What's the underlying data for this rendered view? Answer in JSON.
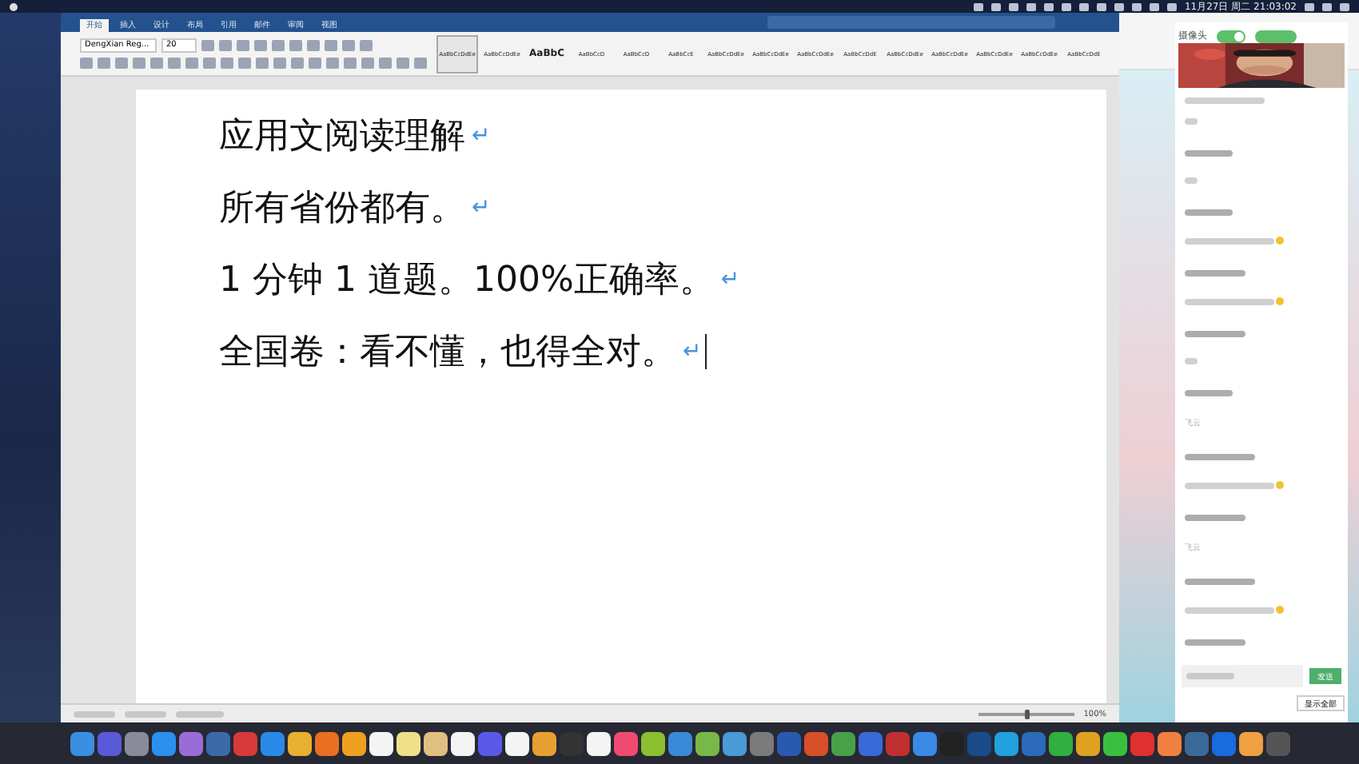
{
  "menu_bar": {
    "clock": "11月27日 周二 21:03:02"
  },
  "word": {
    "tabs": [
      {
        "label": "开始",
        "selected": true
      },
      {
        "label": "插入",
        "selected": false
      },
      {
        "label": "设计",
        "selected": false
      },
      {
        "label": "布局",
        "selected": false
      },
      {
        "label": "引用",
        "selected": false
      },
      {
        "label": "邮件",
        "selected": false
      },
      {
        "label": "审阅",
        "selected": false
      },
      {
        "label": "视图",
        "selected": false
      }
    ],
    "font": "DengXian Reg...",
    "size": "20",
    "styles": [
      {
        "sample": "AaBbCcDdEe",
        "selected": true
      },
      {
        "sample": "AaBbCcDdEe",
        "selected": false
      },
      {
        "sample": "AaBbC",
        "selected": false
      },
      {
        "sample": "AaBbCcD",
        "selected": false
      },
      {
        "sample": "AaBbCcD",
        "selected": false
      },
      {
        "sample": "AaBbCcE",
        "selected": false
      },
      {
        "sample": "AaBbCcDdEe",
        "selected": false
      },
      {
        "sample": "AaBbCcDdEe",
        "selected": false
      },
      {
        "sample": "AaBbCcDdEe",
        "selected": false
      },
      {
        "sample": "AaBbCcDdE",
        "selected": false
      },
      {
        "sample": "AaBbCcDdEe",
        "selected": false
      },
      {
        "sample": "AaBbCcDdEe",
        "selected": false
      },
      {
        "sample": "AaBbCcDdEe",
        "selected": false
      },
      {
        "sample": "AaBbCcDdEe",
        "selected": false
      },
      {
        "sample": "AaBbCcDdE",
        "selected": false
      }
    ],
    "paragraphs": [
      {
        "text": "应用文阅读理解",
        "mark": "↵",
        "cursor": false
      },
      {
        "text": "所有省份都有。",
        "mark": "↵",
        "cursor": false
      },
      {
        "text": "1 分钟 1 道题。100%正确率。",
        "mark": "↵",
        "cursor": false
      },
      {
        "text": "全国卷：看不懂，也得全对。",
        "mark": "↵",
        "cursor": true
      }
    ],
    "zoom": "100%",
    "zoom_slider": {
      "level": 0.5
    }
  },
  "live": {
    "camera_label": "摄像头",
    "camera_on": true,
    "messages": [
      {
        "emoji": false
      },
      {
        "emoji": false
      },
      {
        "emoji": true
      },
      {
        "emoji": true
      },
      {
        "emoji": false
      },
      {
        "sender": "飞云",
        "emoji": false
      },
      {
        "emoji": true
      },
      {
        "sender": "飞云",
        "emoji": false
      },
      {
        "emoji": true
      }
    ],
    "send": "发送",
    "show_all": "显示全部"
  }
}
